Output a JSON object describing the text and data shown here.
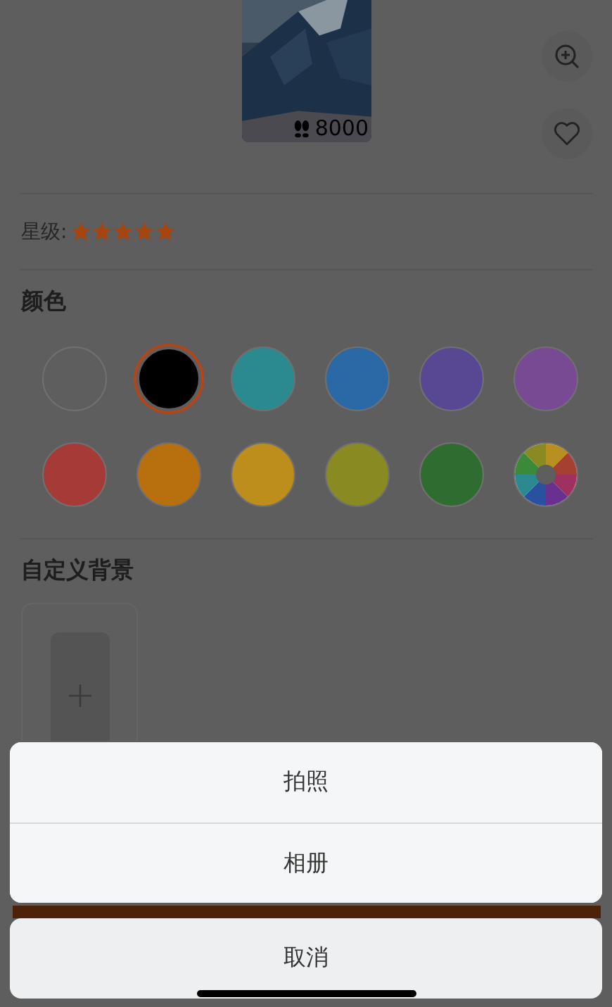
{
  "preview": {
    "steps": "8000"
  },
  "rating": {
    "label": "星级:",
    "stars": 5
  },
  "color_section": {
    "title": "颜色",
    "swatches": [
      {
        "kind": "solid",
        "color": "#5e5e5e",
        "selected": false
      },
      {
        "kind": "solid",
        "color": "#000000",
        "selected": true
      },
      {
        "kind": "solid",
        "color": "#2a8a90",
        "selected": false
      },
      {
        "kind": "solid",
        "color": "#2a68a6",
        "selected": false
      },
      {
        "kind": "solid",
        "color": "#584893",
        "selected": false
      },
      {
        "kind": "solid",
        "color": "#784a94",
        "selected": false
      },
      {
        "kind": "solid",
        "color": "#a63a37",
        "selected": false
      },
      {
        "kind": "solid",
        "color": "#b8700e",
        "selected": false
      },
      {
        "kind": "solid",
        "color": "#be8e1c",
        "selected": false
      },
      {
        "kind": "solid",
        "color": "#8a8a22",
        "selected": false
      },
      {
        "kind": "solid",
        "color": "#2e6c30",
        "selected": false
      },
      {
        "kind": "wheel",
        "selected": false
      }
    ]
  },
  "custom_background": {
    "title": "自定义背景"
  },
  "action_sheet": {
    "options": [
      "拍照",
      "相册"
    ],
    "cancel": "取消"
  }
}
